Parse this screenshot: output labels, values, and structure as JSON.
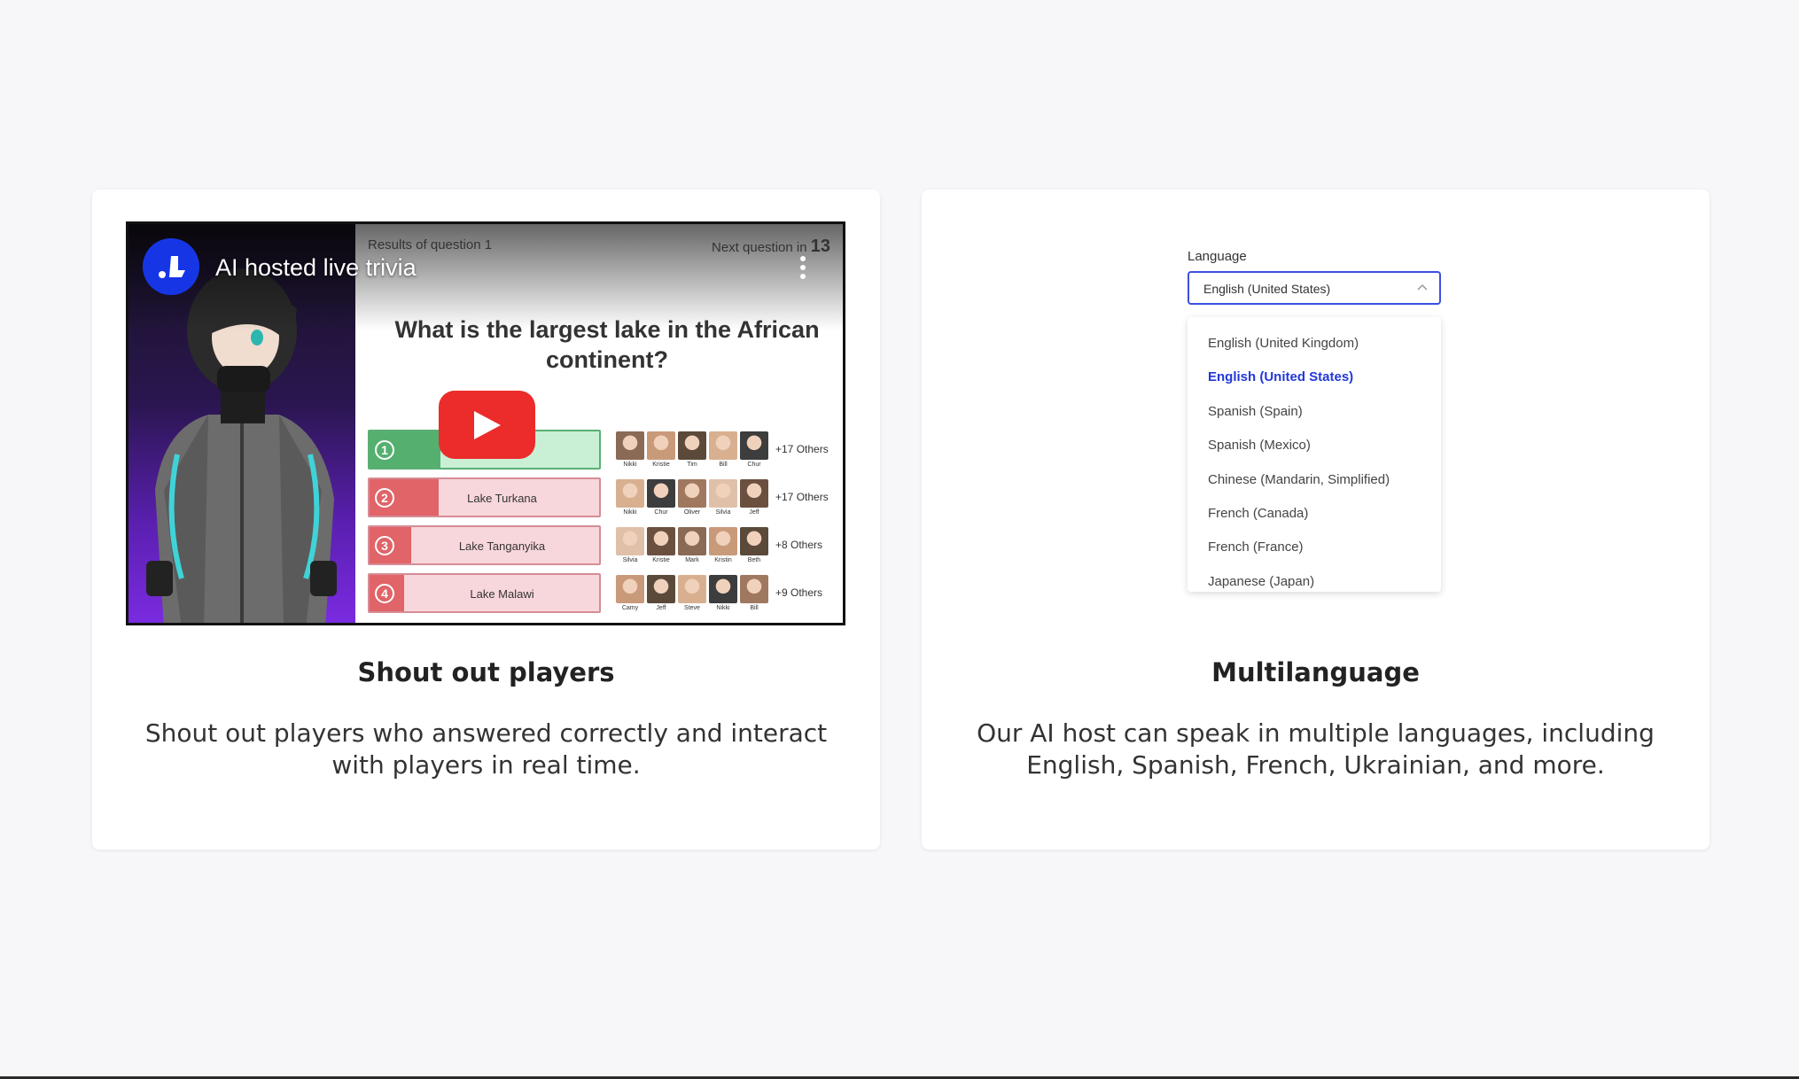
{
  "cards": {
    "shoutout": {
      "title": "Shout out players",
      "description": "Shout out players who answered correctly and interact with players in real time."
    },
    "multilanguage": {
      "title": "Multilanguage",
      "description": "Our AI host can speak in multiple languages, including English, Spanish, French, Ukrainian, and more."
    }
  },
  "video": {
    "title": "AI hosted live trivia",
    "results_label": "Results of question 1",
    "next_question_label": "Next question in",
    "next_question_seconds": "13",
    "question": "What is the largest lake in the African continent?",
    "answers": [
      {
        "num": "1",
        "label": "",
        "correct": true,
        "fill": 0.31,
        "others": "+17 Others",
        "players": [
          "Nikki",
          "Kristie",
          "Tim",
          "Bill",
          "Chur"
        ]
      },
      {
        "num": "2",
        "label": "Lake Turkana",
        "correct": false,
        "fill": 0.3,
        "others": "+17 Others",
        "players": [
          "Nikki",
          "Chur",
          "Oliver",
          "Silvia",
          "Jeff"
        ]
      },
      {
        "num": "3",
        "label": "Lake Tanganyika",
        "correct": false,
        "fill": 0.18,
        "others": "+8 Others",
        "players": [
          "Silvia",
          "Kristie",
          "Mark",
          "Kristin",
          "Beth"
        ]
      },
      {
        "num": "4",
        "label": "Lake Malawi",
        "correct": false,
        "fill": 0.15,
        "others": "+9 Others",
        "players": [
          "Camy",
          "Jeff",
          "Steve",
          "Nikki",
          "Bill"
        ]
      }
    ]
  },
  "language": {
    "label": "Language",
    "selected": "English (United States)",
    "options": [
      "English (United Kingdom)",
      "English (United States)",
      "Spanish (Spain)",
      "Spanish (Mexico)",
      "Chinese (Mandarin, Simplified)",
      "French (Canada)",
      "French (France)",
      "Japanese (Japan)"
    ]
  },
  "colors": {
    "accent": "#2238d8",
    "correct": "#55b06f",
    "wrong": "#e06468",
    "play": "#ec2b2b"
  }
}
